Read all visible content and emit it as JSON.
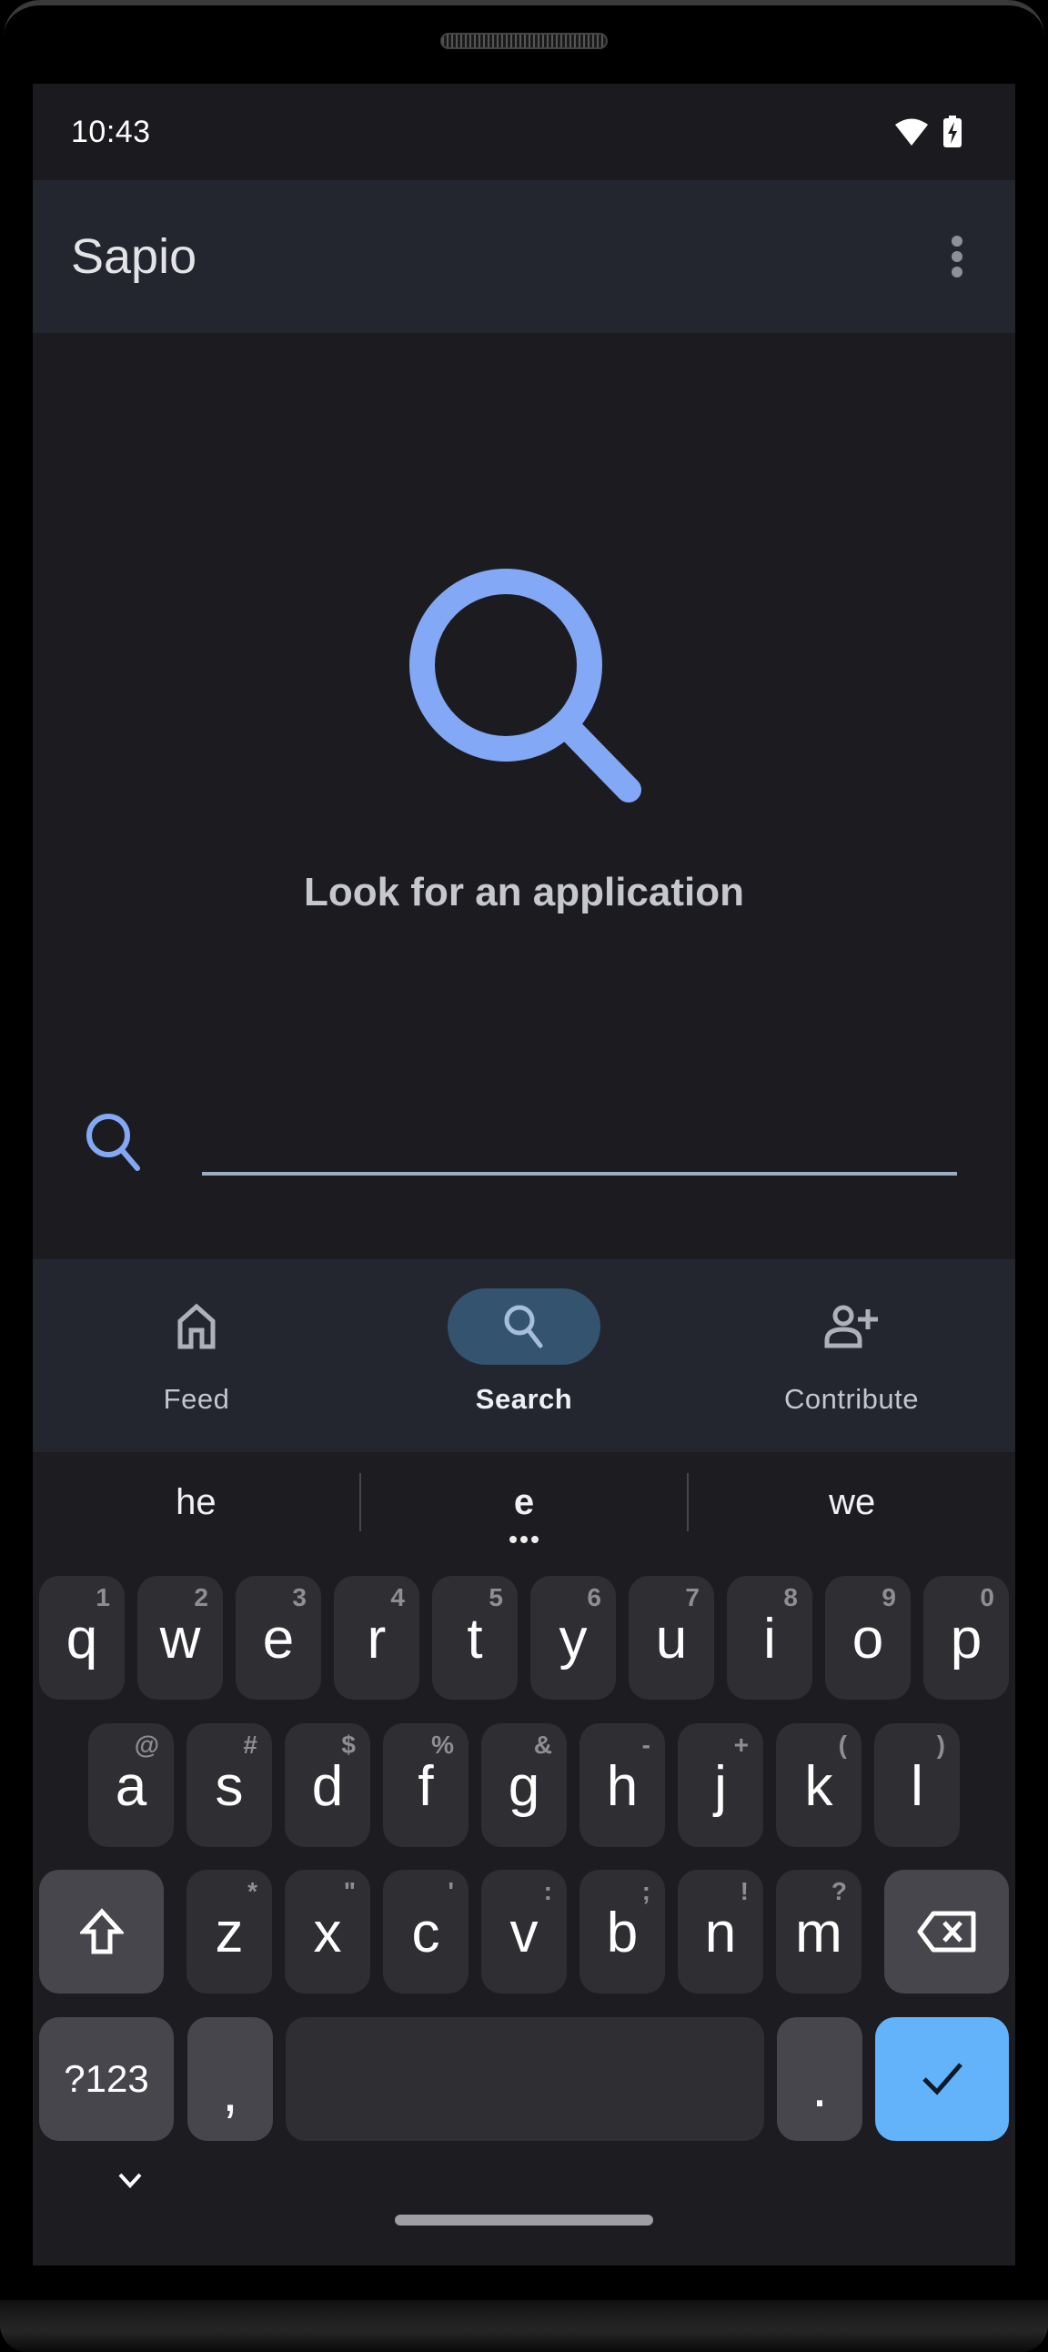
{
  "status_bar": {
    "time": "10:43",
    "icons": [
      "wifi-icon",
      "battery-charging-icon"
    ]
  },
  "app_bar": {
    "title": "Sapio",
    "menu_icon": "more-vert-icon"
  },
  "search_page": {
    "hero_icon": "search-icon",
    "hero_text": "Look for an application",
    "search_input": {
      "value": "",
      "placeholder": ""
    }
  },
  "bottom_nav": {
    "items": [
      {
        "label": "Feed",
        "icon": "home-icon",
        "active": false
      },
      {
        "label": "Search",
        "icon": "search-icon",
        "active": true
      },
      {
        "label": "Contribute",
        "icon": "person-add-icon",
        "active": false
      }
    ]
  },
  "keyboard": {
    "suggestions": [
      "he",
      "e",
      "we"
    ],
    "rows": [
      [
        {
          "key": "q",
          "hint": "1"
        },
        {
          "key": "w",
          "hint": "2"
        },
        {
          "key": "e",
          "hint": "3"
        },
        {
          "key": "r",
          "hint": "4"
        },
        {
          "key": "t",
          "hint": "5"
        },
        {
          "key": "y",
          "hint": "6"
        },
        {
          "key": "u",
          "hint": "7"
        },
        {
          "key": "i",
          "hint": "8"
        },
        {
          "key": "o",
          "hint": "9"
        },
        {
          "key": "p",
          "hint": "0"
        }
      ],
      [
        {
          "key": "a",
          "hint": "@"
        },
        {
          "key": "s",
          "hint": "#"
        },
        {
          "key": "d",
          "hint": "$"
        },
        {
          "key": "f",
          "hint": "%"
        },
        {
          "key": "g",
          "hint": "&"
        },
        {
          "key": "h",
          "hint": "-"
        },
        {
          "key": "j",
          "hint": "+"
        },
        {
          "key": "k",
          "hint": "("
        },
        {
          "key": "l",
          "hint": ")"
        }
      ],
      [
        {
          "key": "z",
          "hint": "*"
        },
        {
          "key": "x",
          "hint": "\""
        },
        {
          "key": "c",
          "hint": "'"
        },
        {
          "key": "v",
          "hint": ":"
        },
        {
          "key": "b",
          "hint": ";"
        },
        {
          "key": "n",
          "hint": "!"
        },
        {
          "key": "m",
          "hint": "?"
        }
      ]
    ],
    "symbols_label": "?123",
    "comma": ",",
    "period": ".",
    "shift_icon": "shift-icon",
    "backspace_icon": "backspace-icon",
    "enter_icon": "check-icon",
    "collapse_icon": "chevron-down-icon",
    "enter_color": "#63b3fb"
  },
  "colors": {
    "accent": "#a8c7fa",
    "nav_active_pill": "#34536f",
    "app_bar_bg": "#23262f",
    "screen_bg": "#1c1c20"
  }
}
